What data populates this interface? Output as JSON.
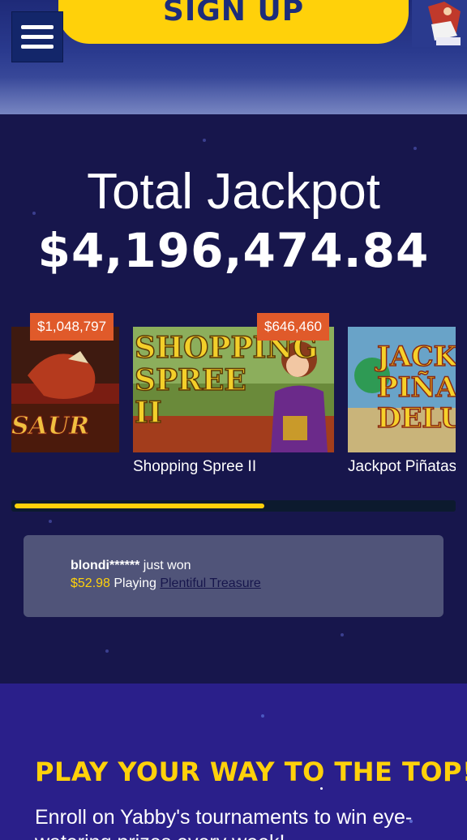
{
  "header": {
    "signup_label": "SIGN UP"
  },
  "jackpot": {
    "title": "Total Jackpot",
    "amount": "$4,196,474.84",
    "cards": [
      {
        "badge": "$1,048,797",
        "name": "",
        "art_text": "SAUR"
      },
      {
        "badge": "$646,460",
        "name": "Shopping Spree II",
        "art_text": "SHOPPING SPREE II"
      },
      {
        "badge": "",
        "name": "Jackpot Piñatas",
        "art_text": "JACK PIÑA DELU"
      }
    ],
    "carousel_progress": 0.57
  },
  "recent_win": {
    "user": "blondi******",
    "action": " just won",
    "amount": "$52.98",
    "playing_label": " Playing ",
    "game": "Plentiful Treasure"
  },
  "tournaments": {
    "heading": "PLAY YOUR WAY TO THE TOP!",
    "text": "Enroll on Yabby's tournaments to win eye-watering prizes every week!"
  },
  "colors": {
    "accent_yellow": "#ffd10a",
    "badge_orange": "#e05a2a",
    "bg_navy": "#17164c",
    "bg_purple": "#2a1f8a"
  }
}
